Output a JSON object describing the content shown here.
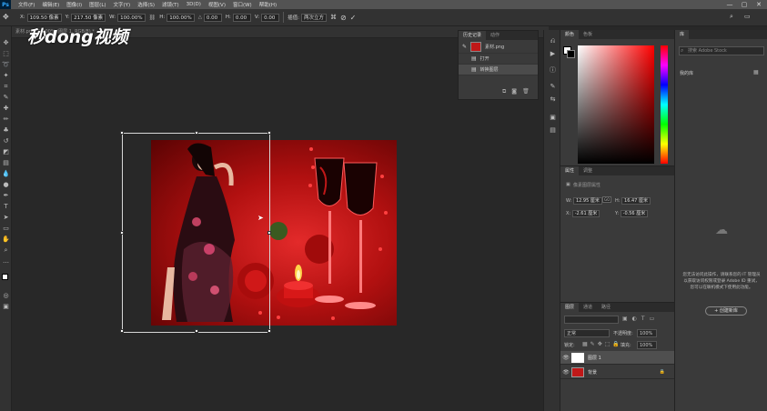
{
  "menubar": {
    "app_logo": "Ps",
    "items": [
      "文件(F)",
      "编辑(E)",
      "图像(I)",
      "图层(L)",
      "文字(Y)",
      "选择(S)",
      "滤镜(T)",
      "3D(D)",
      "视图(V)",
      "窗口(W)",
      "帮助(H)"
    ],
    "window_controls": [
      "—",
      "▢",
      "✕"
    ]
  },
  "options_bar": {
    "x_label": "X:",
    "x_value": "109.50 像素",
    "y_label": "Y:",
    "y_value": "217.50 像素",
    "w_label": "W:",
    "w_value": "100.00%",
    "h_label": "H:",
    "h_value": "100.00%",
    "angle_value": "0.00",
    "hskew_label": "H:",
    "hskew_value": "0.00",
    "vskew_label": "V:",
    "vskew_value": "0.00",
    "interp_label": "插值:",
    "interp_value": "两次立方",
    "cancel_icon": "⊘",
    "commit_icon": "✓"
  },
  "document_tab": {
    "title": "素材.png @ 100% (图层 1, RGB/8) *"
  },
  "watermark": {
    "text": "秒dong视频"
  },
  "history_panel": {
    "tabs": [
      "历史记录",
      "动作"
    ],
    "snapshot_label": "素材.png",
    "entries": [
      "打开",
      "转换图层"
    ]
  },
  "color_panel": {
    "tabs": [
      "颜色",
      "色板"
    ]
  },
  "properties_panel": {
    "tabs": [
      "属性",
      "调整"
    ],
    "subtitle": "像素图层属性",
    "w_label": "W:",
    "w_value": "12.95 厘米",
    "h_label": "H:",
    "h_value": "16.47 厘米",
    "x_label": "X:",
    "x_value": "-2.61 厘米",
    "y_label": "Y:",
    "y_value": "-0.56 厘米",
    "link_icon": "GO"
  },
  "layers_panel": {
    "tabs": [
      "图层",
      "通道",
      "路径"
    ],
    "blend_mode": "正常",
    "opacity_label": "不透明度:",
    "opacity_value": "100%",
    "lock_label": "锁定:",
    "fill_label": "填充:",
    "fill_value": "100%",
    "layers": [
      {
        "name": "图层 1",
        "selected": true
      },
      {
        "name": "背景",
        "selected": false
      }
    ]
  },
  "library_panel": {
    "tab": "库",
    "search_placeholder": "搜索 Adobe Stock",
    "section_label": "我的库",
    "message": "您无法访问此操作，请联系您的 IT 管理员以获取访问权限或登录 Adobe ID 重试，您可以在联机模式下使用此功能。",
    "create_button": "+ 创建新库"
  },
  "colors": {
    "accent": "#31a8ff",
    "menubar_bg": "#535353",
    "panel_bg": "#3a3a3a",
    "canvas_bg": "#282828"
  }
}
